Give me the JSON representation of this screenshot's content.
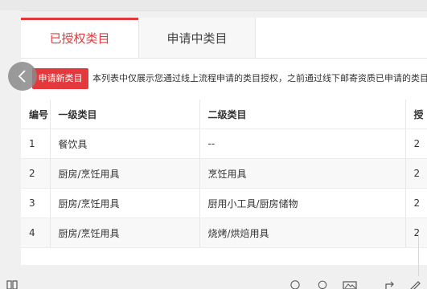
{
  "tabs": [
    {
      "label": "已授权类目",
      "active": true
    },
    {
      "label": "申请中类目",
      "active": false
    }
  ],
  "apply_button": "申请新类目",
  "notice": "本列表中仅展示您通过线上流程申请的类目授权，之前通过线下邮寄资质已申请的类目",
  "table": {
    "headers": [
      "编号",
      "一级类目",
      "二级类目",
      "授"
    ],
    "rows": [
      [
        "1",
        "餐饮具",
        "--",
        "2"
      ],
      [
        "2",
        "厨房/烹饪用具",
        "烹饪用具",
        "2"
      ],
      [
        "3",
        "厨房/烹饪用具",
        "厨用小工具/厨房储物",
        "2"
      ],
      [
        "4",
        "厨房/烹饪用具",
        "烧烤/烘焙用具",
        "2"
      ]
    ]
  },
  "colors": {
    "accent": "#e4393c"
  },
  "icons": [
    "chevron-left-icon",
    "grid-icon",
    "info-icon",
    "search-icon",
    "image-icon",
    "share-icon",
    "edit-icon"
  ]
}
